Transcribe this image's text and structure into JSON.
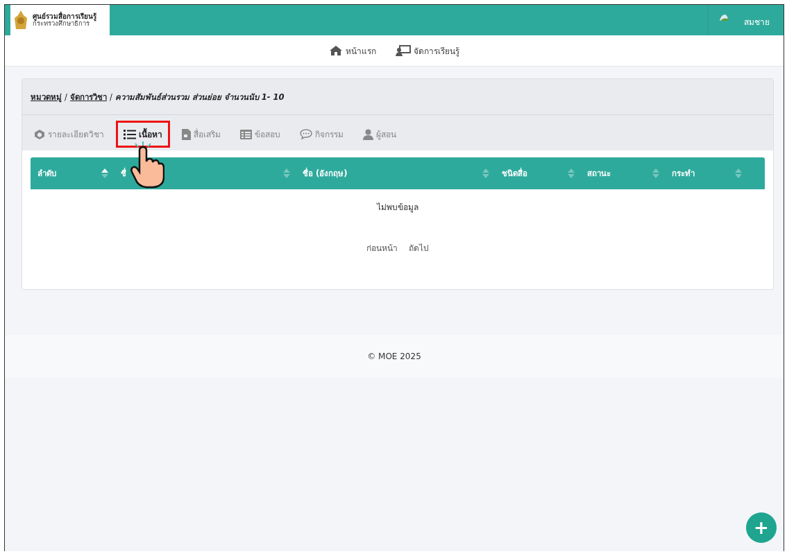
{
  "header": {
    "logo_title": "ศูนย์รวมสื่อการเรียนรู้",
    "logo_subtitle": "กระทรวงศึกษาธิการ",
    "user_name": "สมชาย"
  },
  "nav": [
    {
      "label": "หน้าแรก",
      "kind": "home"
    },
    {
      "label": "จัดการเรียนรู้",
      "kind": "teacher"
    }
  ],
  "breadcrumb": [
    {
      "label": "หมวดหมู่",
      "kind": "link"
    },
    {
      "label": "/",
      "kind": "separator"
    },
    {
      "label": "จัดการวิชา",
      "kind": "link"
    },
    {
      "label": "/",
      "kind": "separator"
    },
    {
      "label": "ความสัมพันธ์ส่วนรวม ส่วนย่อย จำนวนนับ 1- 10",
      "kind": "current"
    }
  ],
  "tabs": [
    {
      "label": "รายละเอียดวิชา",
      "kind": "cube",
      "selected": false,
      "highlighted": false
    },
    {
      "label": "เนื้อหา",
      "kind": "list",
      "selected": true,
      "highlighted": true
    },
    {
      "label": "สื่อเสริม",
      "kind": "file",
      "selected": false,
      "highlighted": false
    },
    {
      "label": "ข้อสอบ",
      "kind": "table",
      "selected": false,
      "highlighted": false
    },
    {
      "label": "กิจกรรม",
      "kind": "chat",
      "selected": false,
      "highlighted": false
    },
    {
      "label": "ผู้สอน",
      "kind": "user",
      "selected": false,
      "highlighted": false
    }
  ],
  "table": {
    "columns": [
      {
        "label": "ลำดับ",
        "sorted": true
      },
      {
        "label": "ชื่",
        "sorted": false
      },
      {
        "label": "ชื่อ (อังกฤษ)",
        "sorted": false
      },
      {
        "label": "ชนิดสื่อ",
        "sorted": false
      },
      {
        "label": "สถานะ",
        "sorted": false
      },
      {
        "label": "กระทำ",
        "sorted": false
      }
    ],
    "empty_message": "ไม่พบข้อมูล"
  },
  "pagination": {
    "previous": "ก่อนหน้า",
    "next": "ถัดไป"
  },
  "footer": "© MOE 2025",
  "fab": {
    "label": "+"
  },
  "pointer_cursor": true
}
